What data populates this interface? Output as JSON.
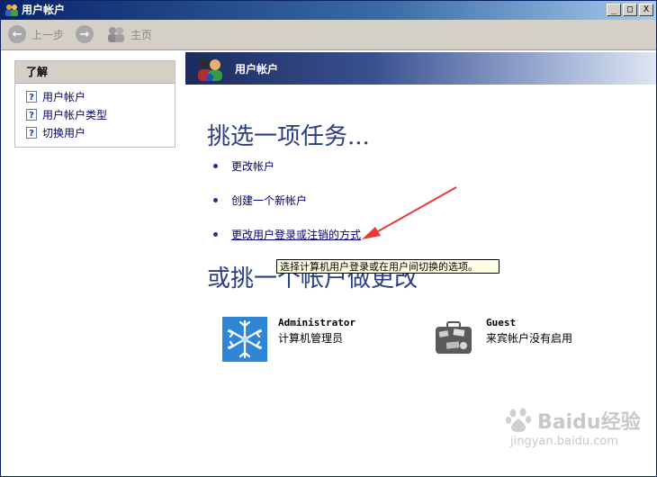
{
  "window": {
    "title": "用户帐户",
    "minimize_glyph": "_",
    "maximize_glyph": "□",
    "close_glyph": "X"
  },
  "toolbar": {
    "back_label": "上一步",
    "forward_icon": "forward-arrow-icon",
    "home_label": "主页"
  },
  "sidebar": {
    "header": "了解",
    "items": [
      {
        "label": "用户帐户",
        "icon": "help-icon"
      },
      {
        "label": "用户帐户类型",
        "icon": "help-icon"
      },
      {
        "label": "切换用户",
        "icon": "help-icon"
      }
    ]
  },
  "banner": {
    "title": "用户帐户"
  },
  "main": {
    "pick_task_heading": "挑选一项任务...",
    "tasks": [
      {
        "label": "更改帐户"
      },
      {
        "label": "创建一个新帐户"
      },
      {
        "label": "更改用户登录或注销的方式"
      }
    ],
    "pick_account_heading": "或挑一个帐户做更改",
    "tooltip": "选择计算机用户登录或在用户间切换的选项。",
    "accounts": [
      {
        "name": "Administrator",
        "description": "计算机管理员",
        "icon": "snowflake-icon"
      },
      {
        "name": "Guest",
        "description": "来宾帐户没有启用",
        "icon": "suitcase-icon"
      }
    ]
  },
  "watermark": {
    "brand": "Baidu经验",
    "url": "jingyan.baidu.com"
  },
  "colors": {
    "link": "#00007a",
    "heading": "#2a3d7f",
    "tooltip_bg": "#ffffe1",
    "annotation_arrow": "#e83a3a"
  }
}
